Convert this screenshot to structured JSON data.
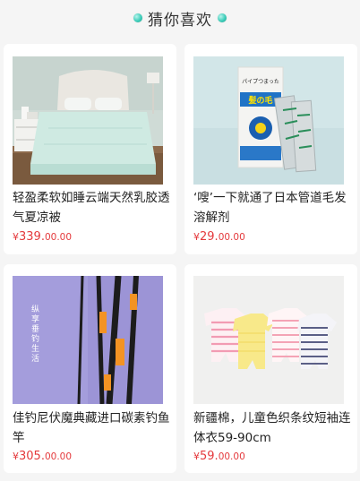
{
  "header": {
    "title": "猜你喜欢",
    "dot_color": "#3ccdb9"
  },
  "products": [
    {
      "name": "轻盈柔软如睡云端天然乳胶透气夏凉被",
      "price_symbol": "¥",
      "price_main": "339.",
      "price_cents": "00.00",
      "image": "bed-quilt-image"
    },
    {
      "name": "‘嗖’一下就通了日本管道毛发溶解剂",
      "price_symbol": "¥",
      "price_main": "29.",
      "price_cents": "00.00",
      "image": "drain-cleaner-image",
      "package_text": "パイプつまった",
      "brand_text": "髪の毛"
    },
    {
      "name": "佳钓尼伏魔典藏进口碳素钓鱼竿",
      "price_symbol": "¥",
      "price_main": "305.",
      "price_cents": "00.00",
      "image": "fishing-rod-image",
      "image_text": "纵享垂钓生活"
    },
    {
      "name": "新疆棉，儿童色织条纹短袖连体衣59-90cm",
      "price_symbol": "¥",
      "price_main": "59.",
      "price_cents": "00.00",
      "image": "kids-romper-image"
    }
  ],
  "colors": {
    "price": "#e4393c",
    "background": "#f5f5f5"
  }
}
